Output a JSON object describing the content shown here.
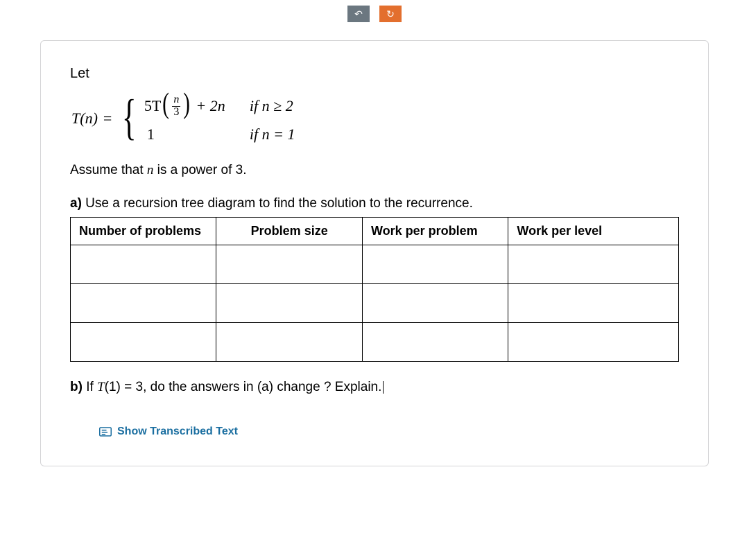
{
  "toolbar": {
    "undo_glyph": "↶",
    "redo_glyph": "↻"
  },
  "problem": {
    "let": "Let",
    "tn_lhs_T": "T",
    "tn_lhs_n": "(n)",
    "equals": "=",
    "case1_5T": "5T",
    "case1_frac_num": "n",
    "case1_frac_den": "3",
    "case1_plus2n": "+ 2n",
    "case1_cond": "if  n ≥ 2",
    "case2_val": "1",
    "case2_cond": "if  n = 1",
    "assume_pre": "Assume that ",
    "assume_var": "n",
    "assume_post": " is a power of 3.",
    "part_a_label": "a)",
    "part_a_text": " Use a recursion tree diagram to find the solution to the recurrence.",
    "table_headers": {
      "h1": "Number of problems",
      "h2": "Problem size",
      "h3": "Work per problem",
      "h4": "Work per level"
    },
    "table_rows": [
      {
        "c1": "",
        "c2": "",
        "c3": "",
        "c4": ""
      },
      {
        "c1": "",
        "c2": "",
        "c3": "",
        "c4": ""
      },
      {
        "c1": "",
        "c2": "",
        "c3": "",
        "c4": ""
      }
    ],
    "part_b_label": "b)",
    "part_b_pre": " If ",
    "part_b_T": "T",
    "part_b_arg": "(1)  =  3",
    "part_b_post": ", do the answers in (a) change ? Explain."
  },
  "footer": {
    "transcribed": "Show Transcribed Text"
  }
}
